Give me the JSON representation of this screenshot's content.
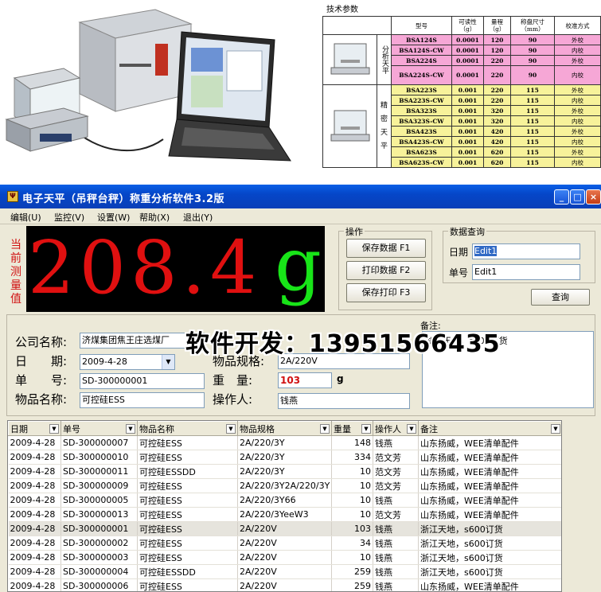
{
  "spec": {
    "title": "技术参数",
    "headers": [
      "型号",
      "可读性\n（g）",
      "量程\n（g）",
      "称盘尺寸\n（mm）",
      "校准方式"
    ],
    "group1_label": "分析天平",
    "group2_label": [
      "精",
      "密",
      "天",
      "平"
    ],
    "rows_analytical": [
      {
        "model": "BSA124S",
        "read": "0.0001",
        "range": "120",
        "pan": "90",
        "cal": "外校"
      },
      {
        "model": "BSA124S-CW",
        "read": "0.0001",
        "range": "120",
        "pan": "90",
        "cal": "内校"
      },
      {
        "model": "BSA224S",
        "read": "0.0001",
        "range": "220",
        "pan": "90",
        "cal": "外校"
      },
      {
        "model": "BSA224S-CW",
        "read": "0.0001",
        "range": "220",
        "pan": "90",
        "cal": "内校"
      }
    ],
    "rows_precision": [
      {
        "model": "BSA223S",
        "read": "0.001",
        "range": "220",
        "pan": "115",
        "cal": "外校"
      },
      {
        "model": "BSA223S-CW",
        "read": "0.001",
        "range": "220",
        "pan": "115",
        "cal": "内校"
      },
      {
        "model": "BSA323S",
        "read": "0.001",
        "range": "320",
        "pan": "115",
        "cal": "外校"
      },
      {
        "model": "BSA323S-CW",
        "read": "0.001",
        "range": "320",
        "pan": "115",
        "cal": "内校"
      },
      {
        "model": "BSA423S",
        "read": "0.001",
        "range": "420",
        "pan": "115",
        "cal": "外校"
      },
      {
        "model": "BSA423S-CW",
        "read": "0.001",
        "range": "420",
        "pan": "115",
        "cal": "内校"
      },
      {
        "model": "BSA623S",
        "read": "0.001",
        "range": "620",
        "pan": "115",
        "cal": "外校"
      },
      {
        "model": "BSA623S-CW",
        "read": "0.001",
        "range": "620",
        "pan": "115",
        "cal": "内校"
      }
    ]
  },
  "window": {
    "title": "电子天平（吊秤台秤）称重分析软件3.2版",
    "minimize": "_",
    "maximize": "□",
    "close": "×"
  },
  "menu": [
    "编辑(U)",
    "监控(V)",
    "设置(W)",
    "帮助(X)",
    "退出(Y)"
  ],
  "display": {
    "label": "当前测量值",
    "value": "208.4",
    "unit": "g"
  },
  "ops": {
    "legend": "操作",
    "save": "保存数据 F1",
    "print": "打印数据 F2",
    "save_print": "保存打印 F3"
  },
  "query": {
    "legend": "数据查询",
    "date_label": "日期",
    "date_value": "Edit1",
    "no_label": "单号",
    "no_value": "Edit1",
    "button": "查询"
  },
  "form": {
    "company_label": "公司名称:",
    "company_value": "济煤集团焦王庄选煤厂",
    "date_label": "日　　期:",
    "date_value": "2009-4-28",
    "no_label": "单　　号:",
    "no_value": "SD-300000001",
    "item_label": "物品名称:",
    "item_value": "可控硅ESS",
    "spec_label": "物品规格:",
    "spec_value": "2A/220V",
    "weight_label": "重　量:",
    "weight_value": "103",
    "weight_unit": "g",
    "operator_label": "操作人:",
    "operator_value": "钱燕",
    "remark_label": "备注:",
    "remark_value": "浙江天地，s600订货",
    "watermark": "软件开发：13951566435"
  },
  "grid": {
    "columns": [
      "日期",
      "单号",
      "物品名称",
      "物品规格",
      "重量",
      "操作人",
      "备注"
    ],
    "rows": [
      [
        "2009-4-28",
        "SD-300000007",
        "可控硅ESS",
        "2A/220/3Y",
        "148",
        "钱燕",
        "山东扬威，WEE清单配件"
      ],
      [
        "2009-4-28",
        "SD-300000010",
        "可控硅ESS",
        "2A/220/3Y",
        "334",
        "范文芳",
        "山东扬威，WEE清单配件"
      ],
      [
        "2009-4-28",
        "SD-300000011",
        "可控硅ESSDD",
        "2A/220/3Y",
        "10",
        "范文芳",
        "山东扬威，WEE清单配件"
      ],
      [
        "2009-4-28",
        "SD-300000009",
        "可控硅ESS",
        "2A/220/3Y2A/220/3Y",
        "10",
        "范文芳",
        "山东扬威，WEE清单配件"
      ],
      [
        "2009-4-28",
        "SD-300000005",
        "可控硅ESS",
        "2A/220/3Y66",
        "10",
        "钱燕",
        "山东扬威，WEE清单配件"
      ],
      [
        "2009-4-28",
        "SD-300000013",
        "可控硅ESS",
        "2A/220/3YeeW3",
        "10",
        "范文芳",
        "山东扬威，WEE清单配件"
      ],
      [
        "2009-4-28",
        "SD-300000001",
        "可控硅ESS",
        "2A/220V",
        "103",
        "钱燕",
        "浙江天地，s600订货"
      ],
      [
        "2009-4-28",
        "SD-300000002",
        "可控硅ESS",
        "2A/220V",
        "34",
        "钱燕",
        "浙江天地，s600订货"
      ],
      [
        "2009-4-28",
        "SD-300000003",
        "可控硅ESS",
        "2A/220V",
        "10",
        "钱燕",
        "浙江天地，s600订货"
      ],
      [
        "2009-4-28",
        "SD-300000004",
        "可控硅ESSDD",
        "2A/220V",
        "259",
        "钱燕",
        "浙江天地，s600订货"
      ],
      [
        "2009-4-28",
        "SD-300000006",
        "可控硅ESS",
        "2A/220V",
        "259",
        "钱燕",
        "山东扬威，WEE清单配件"
      ]
    ],
    "highlight_row": 6
  },
  "colors": {
    "display_value": "#e01010",
    "display_unit": "#18e418",
    "weight_value": "#d01010",
    "spec_pink": "#f6a7d6",
    "spec_yellow": "#f7f29a"
  }
}
